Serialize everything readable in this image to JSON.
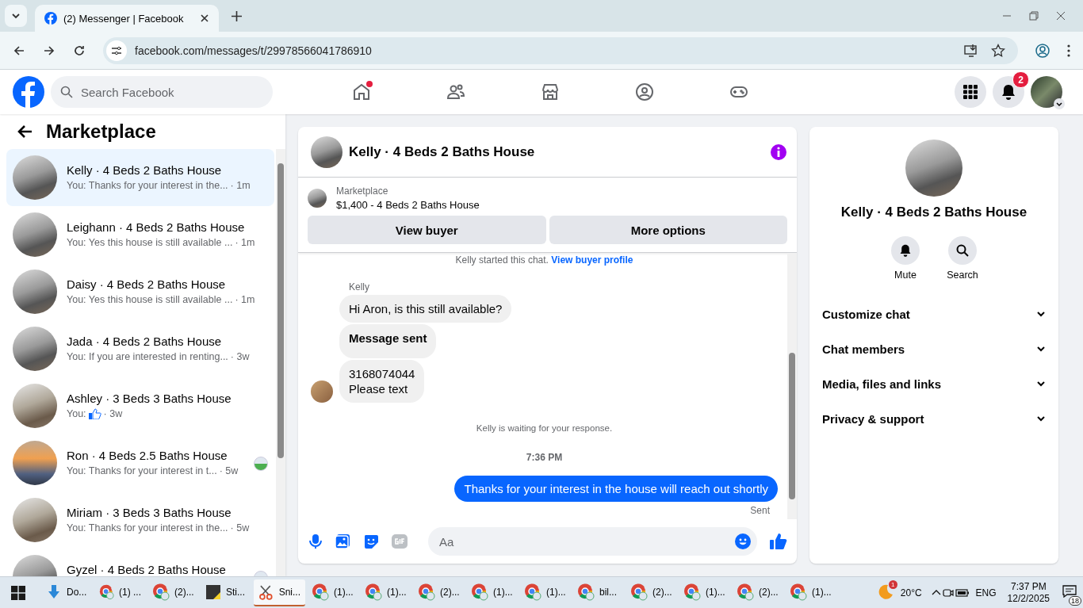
{
  "browser": {
    "tab_title": "(2) Messenger | Facebook",
    "url": "facebook.com/messages/t/29978566041786910"
  },
  "header": {
    "search_placeholder": "Search Facebook",
    "nav": [
      {
        "kind": "home",
        "dot": true
      },
      {
        "kind": "friends",
        "dot": false
      },
      {
        "kind": "marketplace",
        "dot": false
      },
      {
        "kind": "groups",
        "dot": false
      },
      {
        "kind": "gaming",
        "dot": false
      }
    ],
    "notification_count": "2"
  },
  "sidebar": {
    "title": "Marketplace",
    "conversations": [
      {
        "title": "Kelly · 4 Beds 2 Baths House",
        "preview": "You: Thanks for your interest in the...",
        "time": "· 1m",
        "selected": true,
        "like": false,
        "seen": false
      },
      {
        "title": "Leighann · 4 Beds 2 Baths House",
        "preview": "You: Yes this house is still available ...",
        "time": "· 1m",
        "selected": false,
        "like": false,
        "seen": false
      },
      {
        "title": "Daisy · 4 Beds 2 Baths House",
        "preview": "You: Yes this house is still available ...",
        "time": "· 1m",
        "selected": false,
        "like": false,
        "seen": false
      },
      {
        "title": "Jada · 4 Beds 2 Baths House",
        "preview": "You: If you are interested in renting...",
        "time": "· 3w",
        "selected": false,
        "like": false,
        "seen": false
      },
      {
        "title": "Ashley · 3 Beds 3 Baths House",
        "preview": "You:",
        "time": "· 3w",
        "selected": false,
        "like": true,
        "seen": false
      },
      {
        "title": "Ron · 4 Beds 2.5 Baths House",
        "preview": "You: Thanks for your interest in t...",
        "time": "· 5w",
        "selected": false,
        "like": false,
        "seen": true
      },
      {
        "title": "Miriam · 3 Beds 3 Baths House",
        "preview": "You: Thanks for your interest in the...",
        "time": "· 5w",
        "selected": false,
        "like": false,
        "seen": false
      },
      {
        "title": "Gyzel · 4 Beds 2 Baths House",
        "selected": false,
        "seen": true
      }
    ]
  },
  "chat": {
    "title": "Kelly · 4 Beds 2 Baths House",
    "listing_label": "Marketplace",
    "listing_title": "$1,400 - 4 Beds 2 Baths House",
    "buttons": [
      "View buyer",
      "More options"
    ],
    "notice": "Kelly started this chat.",
    "notice_link": "View buyer profile",
    "sender": "Kelly",
    "messages": [
      {
        "text": "Hi Aron, is this still available?",
        "bold": false
      },
      {
        "text": "Message sent",
        "bold": true
      },
      {
        "text": "3168074044\nPlease text",
        "bold": false
      }
    ],
    "waiting": "Kelly is waiting for your response.",
    "time": "7:36 PM",
    "outgoing": "Thanks for your interest in the house will reach out shortly",
    "status": "Sent",
    "composer_placeholder": "Aa"
  },
  "details": {
    "name": "Kelly · 4 Beds 2 Baths House",
    "actions": [
      {
        "kind": "bell",
        "label": "Mute"
      },
      {
        "kind": "search",
        "label": "Search"
      }
    ],
    "sections": [
      "Customize chat",
      "Chat members",
      "Media, files and links",
      "Privacy & support"
    ]
  },
  "taskbar": {
    "apps": [
      {
        "kind": "download",
        "label": "Do...",
        "selected": false
      },
      {
        "kind": "browser",
        "label": "(1) ...",
        "selected": false
      },
      {
        "kind": "browser",
        "label": "(2)...",
        "selected": false
      },
      {
        "kind": "note",
        "label": "Sti...",
        "selected": false
      },
      {
        "kind": "snip",
        "label": "Sni...",
        "selected": true
      },
      {
        "kind": "browser",
        "label": "(1)...",
        "selected": false
      },
      {
        "kind": "browser",
        "label": "(1)...",
        "selected": false
      },
      {
        "kind": "browser",
        "label": "(2)...",
        "selected": false
      },
      {
        "kind": "browser",
        "label": "(1)...",
        "selected": false
      },
      {
        "kind": "browser",
        "label": "(1)...",
        "selected": false
      },
      {
        "kind": "browser",
        "label": "bil...",
        "selected": false
      },
      {
        "kind": "browser",
        "label": "(2)...",
        "selected": false
      },
      {
        "kind": "browser",
        "label": "(1)...",
        "selected": false
      },
      {
        "kind": "browser",
        "label": "(2)...",
        "selected": false
      },
      {
        "kind": "browser",
        "label": "(1)...",
        "selected": false
      }
    ],
    "weather_alert": "1",
    "temperature": "20°C",
    "language": "ENG",
    "time": "7:37 PM",
    "date": "12/2/2025",
    "notifications": "18"
  }
}
